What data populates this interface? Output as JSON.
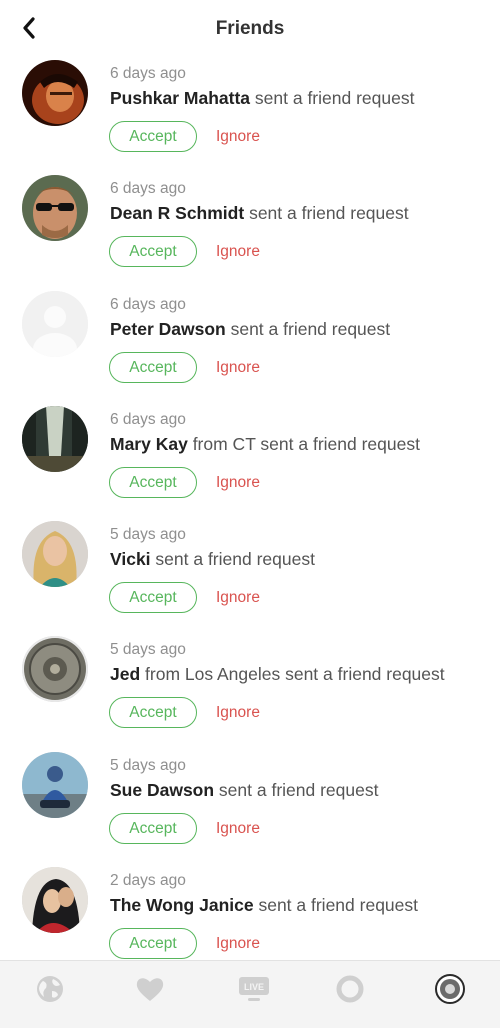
{
  "header": {
    "title": "Friends"
  },
  "buttons": {
    "accept": "Accept",
    "ignore": "Ignore"
  },
  "requests": [
    {
      "time": "6 days ago",
      "name": "Pushkar Mahatta",
      "text": " sent a friend request",
      "avatar": "avatar-pushkar"
    },
    {
      "time": "6 days ago",
      "name": "Dean R Schmidt",
      "text": " sent a friend request",
      "avatar": "avatar-dean"
    },
    {
      "time": "6 days ago",
      "name": "Peter Dawson",
      "text": " sent a friend request",
      "avatar": "avatar-default"
    },
    {
      "time": "6 days ago",
      "name": "Mary Kay",
      "text": " from CT sent a friend request",
      "avatar": "avatar-mary"
    },
    {
      "time": "5 days ago",
      "name": "Vicki",
      "text": " sent a friend request",
      "avatar": "avatar-vicki"
    },
    {
      "time": "5 days ago",
      "name": "Jed",
      "text": " from Los Angeles sent a friend request",
      "avatar": "avatar-jed"
    },
    {
      "time": "5 days ago",
      "name": "Sue Dawson",
      "text": " sent a friend request",
      "avatar": "avatar-sue"
    },
    {
      "time": "2 days ago",
      "name": "The Wong Janice",
      "text": " sent a friend request",
      "avatar": "avatar-wong"
    }
  ],
  "tabbar": {
    "tabs": [
      {
        "icon": "globe-icon"
      },
      {
        "icon": "heart-icon"
      },
      {
        "icon": "live-icon",
        "label": "LIVE"
      },
      {
        "icon": "circle-icon"
      },
      {
        "icon": "profile-avatar-icon"
      }
    ]
  },
  "colors": {
    "accept": "#57b65c",
    "ignore": "#d9534f",
    "tabbar_bg": "#f4f4f4",
    "icon_gray": "#cfcfcf"
  }
}
